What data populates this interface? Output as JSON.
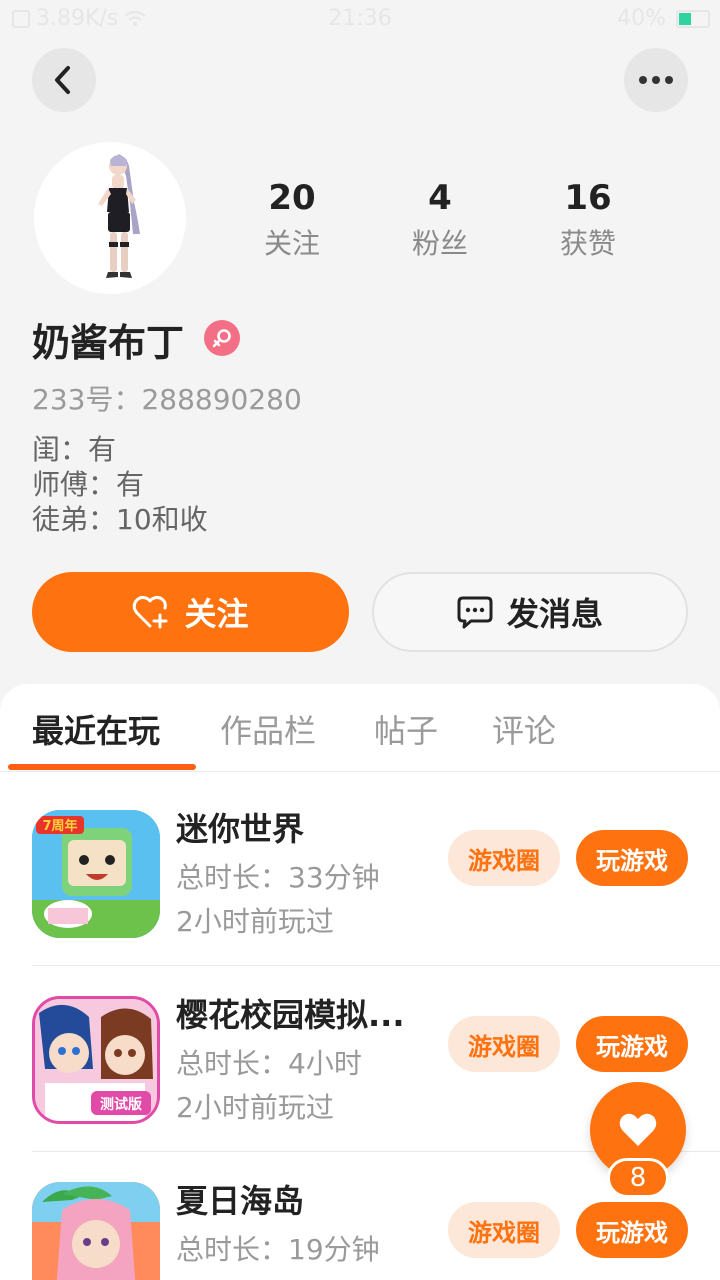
{
  "status_bar": {
    "network_speed": "3.89K/s",
    "time": "21:36",
    "battery": "40%",
    "battery_level": 0.4
  },
  "nav": {
    "back_icon": "chevron-left-icon",
    "more_icon": "more-horizontal-icon"
  },
  "profile": {
    "name": "奶酱布丁",
    "gender_icon": "female-icon",
    "gender_color": "#f36f86",
    "uid_label": "233号：",
    "uid_value": "288890280",
    "stats": [
      {
        "value": "20",
        "label": "关注"
      },
      {
        "value": "4",
        "label": "粉丝"
      },
      {
        "value": "16",
        "label": "获赞"
      }
    ],
    "relations": [
      "闺：有",
      "师傅：有",
      "徒弟：10和收"
    ]
  },
  "actions": {
    "follow_label": "关注",
    "message_label": "发消息",
    "accent_color": "#ff7210"
  },
  "tabs": [
    {
      "label": "最近在玩",
      "active": true
    },
    {
      "label": "作品栏",
      "active": false
    },
    {
      "label": "帖子",
      "active": false
    },
    {
      "label": "评论",
      "active": false
    }
  ],
  "games": [
    {
      "name": "迷你世界",
      "duration": "总时长：33分钟",
      "last_played": "2小时前玩过",
      "circle_label": "游戏圈",
      "play_label": "玩游戏"
    },
    {
      "name": "樱花校园模拟...",
      "duration": "总时长：4小时",
      "last_played": "2小时前玩过",
      "circle_label": "游戏圈",
      "play_label": "玩游戏"
    },
    {
      "name": "夏日海岛",
      "duration": "总时长：19分钟",
      "last_played": "",
      "circle_label": "游戏圈",
      "play_label": "玩游戏"
    }
  ],
  "game_icon_badges": {
    "g1": "7周年",
    "g2": "测试版"
  },
  "like_fab": {
    "icon": "heart-icon",
    "count": "8"
  }
}
